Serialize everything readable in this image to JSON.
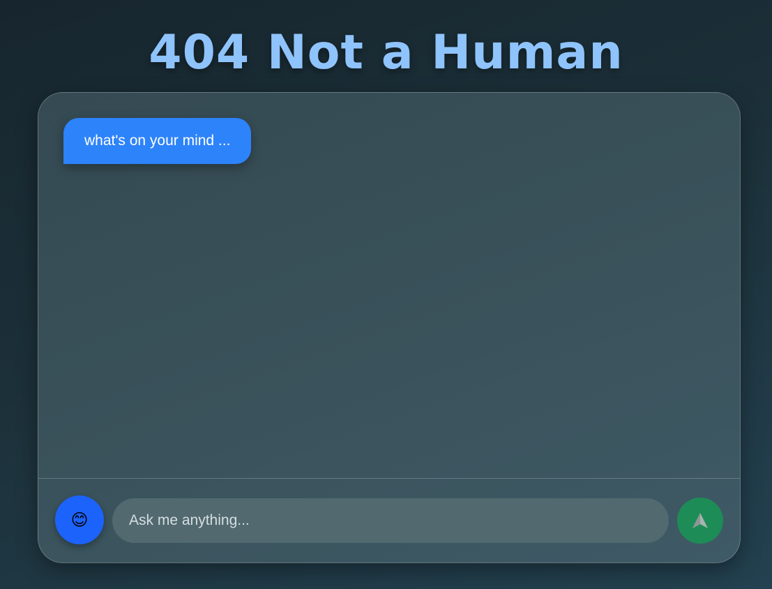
{
  "header": {
    "title": "404 Not a Human"
  },
  "chat": {
    "messages": [
      {
        "sender": "bot",
        "text": "what's on your mind ..."
      }
    ]
  },
  "composer": {
    "emoji_button_glyph": "😊",
    "emoji_icon": "smiling-face-icon",
    "input_placeholder": "Ask me anything...",
    "input_value": "",
    "send_icon": "send-arrow-icon"
  },
  "colors": {
    "title": "#8fc3fb",
    "bubble": "#2d83fa",
    "emoji_button": "#1c63fb",
    "send_button": "#1e8c57"
  }
}
